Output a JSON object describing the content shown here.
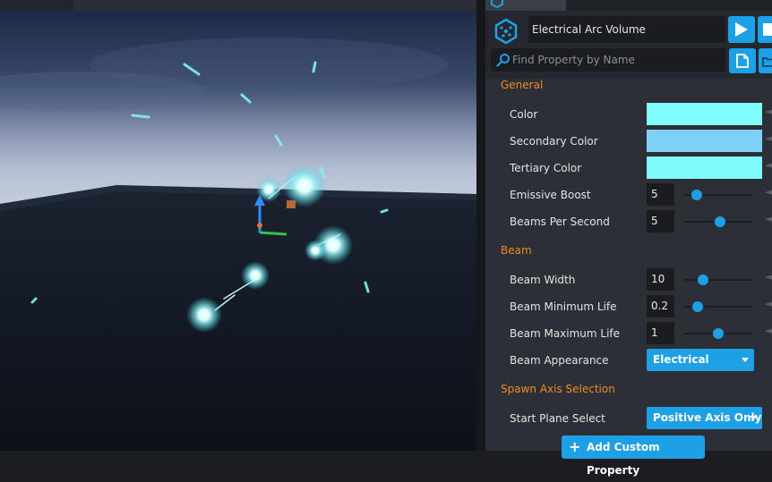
{
  "colors": {
    "accent": "#1ea0e6",
    "section_header": "#f08a24",
    "color_swatch": "#7ffdfd",
    "secondary_color_swatch": "#7fd0f7",
    "tertiary_color_swatch": "#7ffafa"
  },
  "header": {
    "object_icon": "hex-node-icon",
    "object_name": "Electrical Arc Volume",
    "play_icon": "play-icon",
    "stop_icon": "stop-icon",
    "search_icon": "search-icon",
    "search_placeholder": "Find Property by Name",
    "doc_icon": "document-icon",
    "folder_icon": "folder-icon"
  },
  "sections": {
    "general": {
      "title": "General",
      "color_label": "Color",
      "secondary_color_label": "Secondary Color",
      "tertiary_color_label": "Tertiary Color",
      "emissive_boost_label": "Emissive Boost",
      "emissive_boost_value": "5",
      "emissive_boost_fraction": 0.18,
      "beams_per_second_label": "Beams Per Second",
      "beams_per_second_value": "5",
      "beams_per_second_fraction": 0.52
    },
    "beam": {
      "title": "Beam",
      "width_label": "Beam Width",
      "width_value": "10",
      "width_fraction": 0.28,
      "min_life_label": "Beam Minimum Life",
      "min_life_value": "0.2",
      "min_life_fraction": 0.2,
      "max_life_label": "Beam Maximum Life",
      "max_life_value": "1",
      "max_life_fraction": 0.5,
      "appearance_label": "Beam Appearance",
      "appearance_value": "Electrical"
    },
    "spawn": {
      "title": "Spawn Axis Selection",
      "start_plane_label": "Start Plane Select",
      "start_plane_value": "Positive Axis Only"
    }
  },
  "add_custom_property": "Add Custom Property"
}
